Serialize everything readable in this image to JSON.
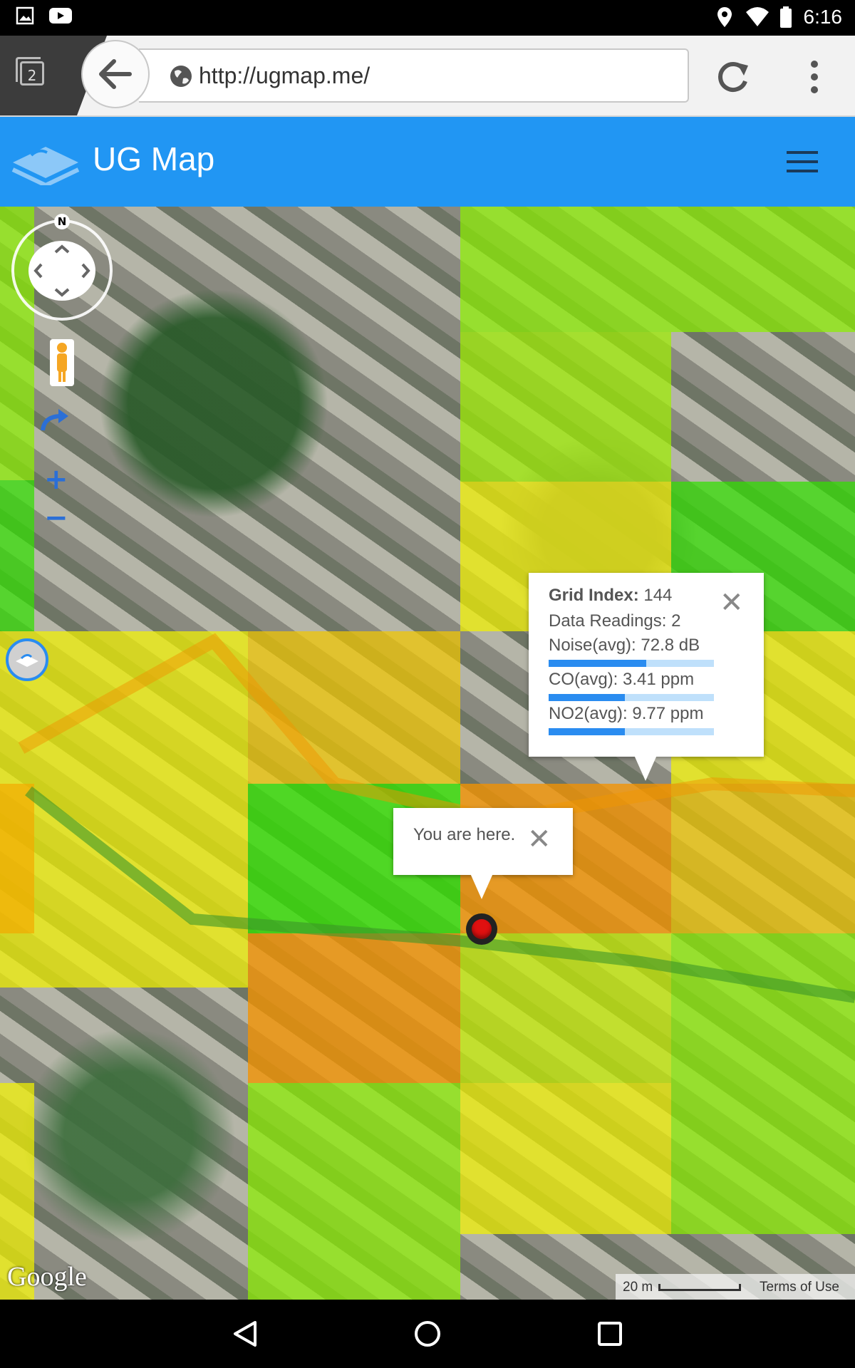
{
  "status_bar": {
    "time": "6:16",
    "icons": [
      "image-icon",
      "youtube-icon",
      "location-icon",
      "wifi-icon",
      "battery-icon"
    ]
  },
  "browser": {
    "tab_count": "2",
    "url": "http://ugmap.me/"
  },
  "app": {
    "title": "UG Map",
    "menu_icon": "hamburger-menu-icon"
  },
  "map": {
    "compass_label": "N",
    "popup_grid": {
      "grid_index_label": "Grid Index:",
      "grid_index_value": "144",
      "readings": "Data Readings: 2",
      "noise": "Noise(avg): 72.8 dB",
      "co": "CO(avg): 3.41 ppm",
      "no2": "NO2(avg): 9.77 ppm",
      "noise_level": 0.59,
      "co_level": 0.46,
      "no2_level": 0.46
    },
    "popup_location": {
      "text": "You are here."
    },
    "attribution": {
      "logo": "Google",
      "scale": "20 m",
      "terms": "Terms of Use"
    },
    "colors": {
      "green": "#32e000",
      "yellow": "#f2f200",
      "orange": "#f39200",
      "lime": "#8cf000"
    }
  }
}
